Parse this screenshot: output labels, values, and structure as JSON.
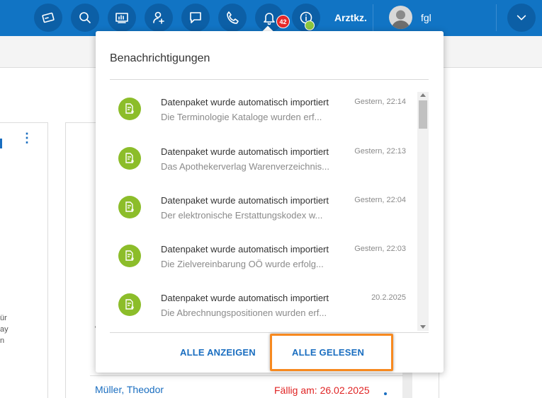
{
  "topbar": {
    "icons": [
      "card-icon",
      "search-icon",
      "monitor-icon",
      "add-user-icon",
      "chat-icon",
      "phone-icon",
      "bell-icon",
      "info-icon"
    ],
    "notification_count": "42",
    "arztkz_label": "Arztkz.",
    "username": "fgl",
    "colors": {
      "bar": "#1174c4",
      "button": "#0c5fa6",
      "badge": "#e52929",
      "check": "#8cc63f"
    }
  },
  "background": {
    "left_fragments": [
      "ür",
      "ay",
      "n"
    ],
    "row": {
      "patient": "Müller, Theodor",
      "due": "Fällig am: 26.02.2025"
    }
  },
  "notifications": {
    "title": "Benachrichtigungen",
    "items": [
      {
        "title": "Datenpaket wurde automatisch importiert",
        "time": "Gestern, 22:14",
        "description": "Die Terminologie Kataloge wurden erf..."
      },
      {
        "title": "Datenpaket wurde automatisch importiert",
        "time": "Gestern, 22:13",
        "description": "Das Apothekerverlag Warenverzeichnis..."
      },
      {
        "title": "Datenpaket wurde automatisch importiert",
        "time": "Gestern, 22:04",
        "description": "Der elektronische Erstattungskodex w..."
      },
      {
        "title": "Datenpaket wurde automatisch importiert",
        "time": "Gestern, 22:03",
        "description": "Die Zielvereinbarung OÖ wurde erfolg..."
      },
      {
        "title": "Datenpaket wurde automatisch importiert",
        "time": "20.2.2025",
        "description": "Die Abrechnungspositionen wurden erf..."
      }
    ],
    "show_all_label": "ALLE ANZEIGEN",
    "mark_read_label": "ALLE GELESEN",
    "colors": {
      "icon": "#8cbd2a",
      "link": "#1a6ec0",
      "highlight": "#f7891f"
    }
  }
}
